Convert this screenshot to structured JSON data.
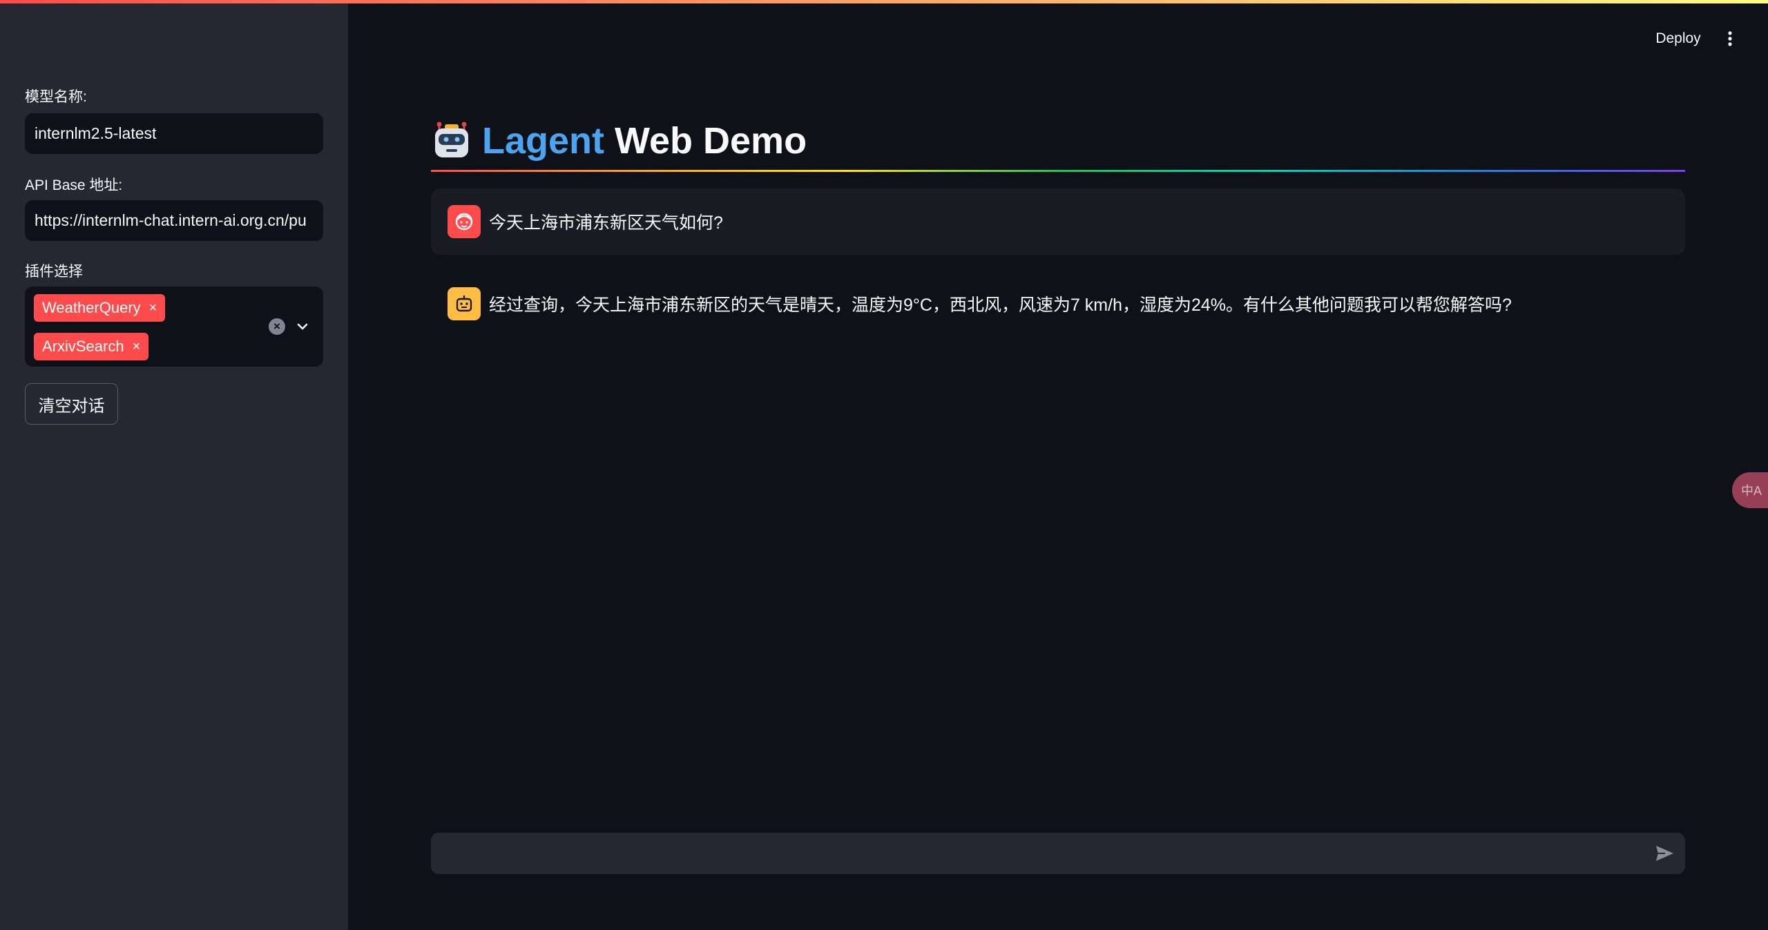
{
  "header": {
    "deploy_label": "Deploy"
  },
  "sidebar": {
    "model_label": "模型名称:",
    "model_value": "internlm2.5-latest",
    "api_label": "API Base 地址:",
    "api_value": "https://internlm-chat.intern-ai.org.cn/pu",
    "plugins_label": "插件选择",
    "plugins": [
      {
        "label": "WeatherQuery",
        "remove": "×"
      },
      {
        "label": "ArxivSearch",
        "remove": "×"
      }
    ],
    "clear_all_glyph": "×",
    "clear_button_label": "清空对话"
  },
  "main": {
    "title_accent": "Lagent",
    "title_rest": " Web Demo",
    "messages": [
      {
        "role": "user",
        "text": "今天上海市浦东新区天气如何?"
      },
      {
        "role": "assistant",
        "text": "经过查询，今天上海市浦东新区的天气是晴天，温度为9°C，西北风，风速为7 km/h，湿度为24%。有什么其他问题我可以帮您解答吗?"
      }
    ],
    "chat_input_value": ""
  },
  "floating": {
    "translate_glyph": "中A"
  },
  "colors": {
    "background": "#0e1117",
    "sidebar": "#262730",
    "accent": "#ff4b4b",
    "title_accent": "#4aa4f0",
    "bot_avatar": "#ffbd45"
  }
}
